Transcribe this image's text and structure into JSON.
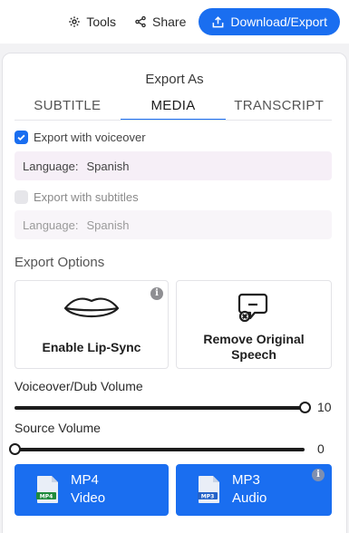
{
  "toolbar": {
    "tools_label": "Tools",
    "share_label": "Share",
    "export_label": "Download/Export"
  },
  "panel": {
    "heading": "Export As",
    "tabs": [
      {
        "label": "SUBTITLE",
        "active": false
      },
      {
        "label": "MEDIA",
        "active": true
      },
      {
        "label": "TRANSCRIPT",
        "active": false
      }
    ],
    "voiceover": {
      "label": "Export with voiceover",
      "checked": true,
      "language_label": "Language:",
      "language_value": "Spanish"
    },
    "subtitles": {
      "label": "Export with subtitles",
      "checked": false,
      "language_label": "Language:",
      "language_value": "Spanish"
    },
    "options_title": "Export Options",
    "options": [
      {
        "label": "Enable Lip-Sync",
        "icon": "lips-icon"
      },
      {
        "label_line1": "Remove Original",
        "label_line2": "Speech",
        "icon": "remove-speech-icon"
      }
    ],
    "voiceover_volume": {
      "label": "Voiceover/Dub Volume",
      "value": "10",
      "fraction": 1.0
    },
    "source_volume": {
      "label": "Source Volume",
      "value": "0",
      "fraction": 0.0
    },
    "formats": [
      {
        "line1": "MP4",
        "line2": "Video",
        "badge": "MP4"
      },
      {
        "line1": "MP3",
        "line2": "Audio",
        "badge": "MP3"
      }
    ]
  },
  "colors": {
    "accent": "#1a6ef0",
    "badge_green": "#1f8a3c",
    "badge_blue": "#2563c9"
  }
}
